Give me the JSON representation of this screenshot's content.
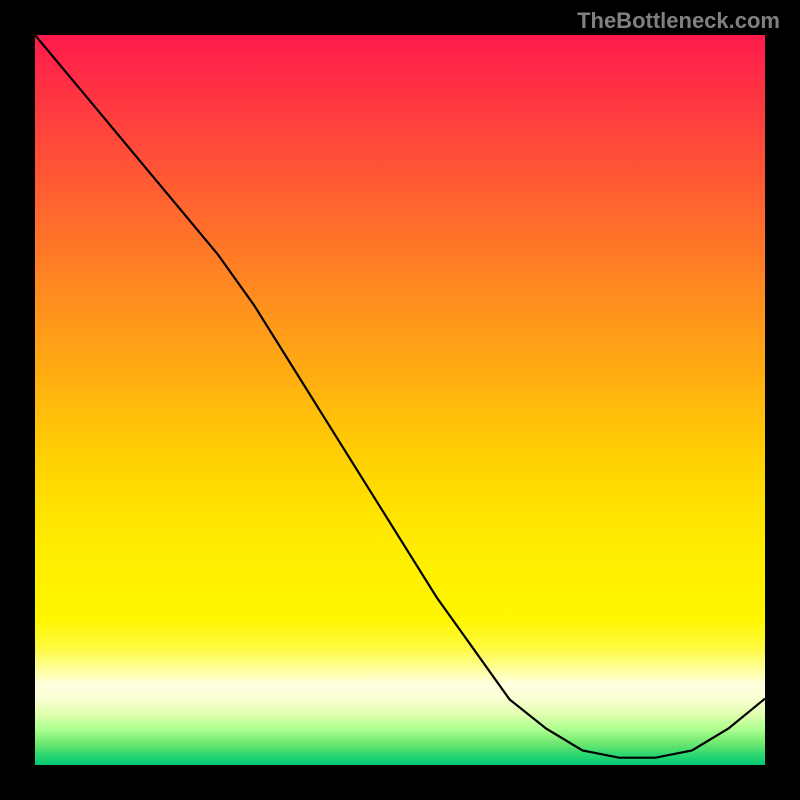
{
  "watermark": "TheBottleneck.com",
  "chart_data": {
    "type": "line",
    "x": [
      0.0,
      0.05,
      0.1,
      0.15,
      0.2,
      0.25,
      0.3,
      0.35,
      0.4,
      0.45,
      0.5,
      0.55,
      0.6,
      0.65,
      0.7,
      0.75,
      0.8,
      0.85,
      0.9,
      0.95,
      1.0
    ],
    "values": [
      1.0,
      0.94,
      0.88,
      0.82,
      0.76,
      0.7,
      0.63,
      0.55,
      0.47,
      0.39,
      0.31,
      0.23,
      0.16,
      0.09,
      0.05,
      0.02,
      0.01,
      0.01,
      0.02,
      0.05,
      0.09
    ],
    "title": "",
    "xlabel": "",
    "ylabel": "",
    "xlim": [
      0,
      1
    ],
    "ylim": [
      0,
      1
    ],
    "series_note": "Single black curve over red-to-green vertical gradient background"
  },
  "gradient": {
    "top": "#ff1a4d",
    "mid": "#ffd600",
    "bottom": "#00c872"
  }
}
